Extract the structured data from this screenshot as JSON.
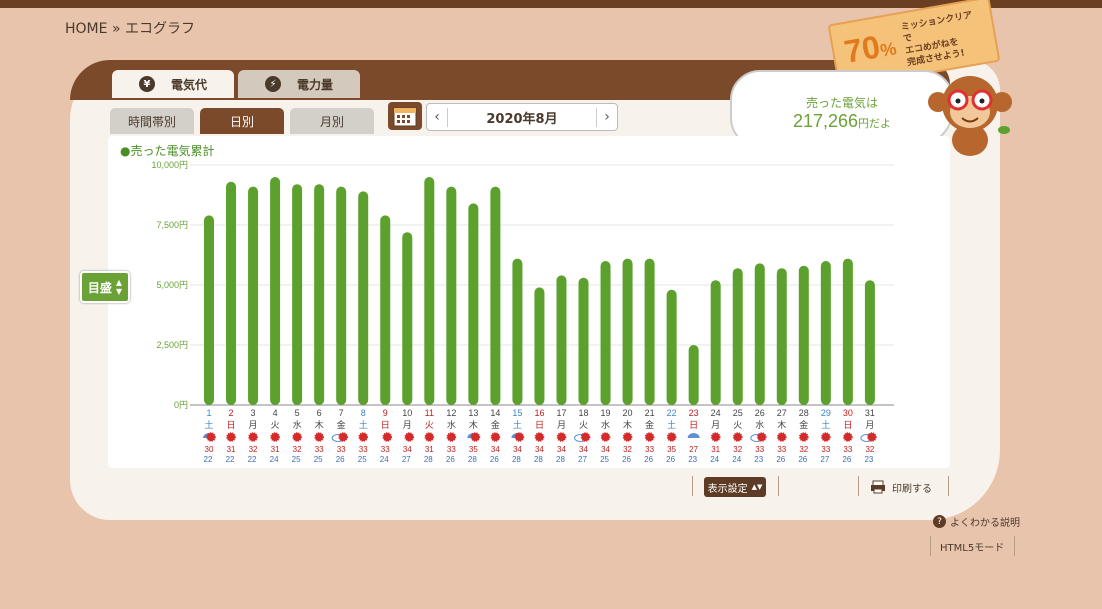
{
  "breadcrumb": {
    "home": "HOME",
    "sep": "»",
    "current": "エコグラフ"
  },
  "mission": {
    "percent": "70",
    "unit": "%",
    "text": "ミッションクリアで\nエコめがねを\n完成させよう!"
  },
  "tabs": [
    {
      "label": "電気代",
      "icon": "yen-icon"
    },
    {
      "label": "電力量",
      "icon": "bolt-icon"
    }
  ],
  "subtabs": [
    "時間帯別",
    "日別",
    "月別"
  ],
  "date": {
    "label": "2020年8月",
    "prev": "‹",
    "next": "›"
  },
  "summary": {
    "line1": "売った電気は",
    "value": "217,266",
    "unit": "円だよ"
  },
  "legend": "●売った電気累計",
  "scale_button": "目盛",
  "footer": {
    "display_settings": "表示設定",
    "print": "印刷する",
    "help": "よくわかる説明",
    "html5": "HTML5モード"
  },
  "colors": {
    "bar": "#5ca12d",
    "weekday": "#444444",
    "saturday": "#3c84cc",
    "sunday": "#c21c1c",
    "accent": "#6aa236"
  },
  "chart_data": {
    "type": "bar",
    "ylim": [
      0,
      10000
    ],
    "yticks": [
      "0円",
      "2,500円",
      "5,000円",
      "7,500円",
      "10,000円"
    ],
    "categories": [
      "1",
      "2",
      "3",
      "4",
      "5",
      "6",
      "7",
      "8",
      "9",
      "10",
      "11",
      "12",
      "13",
      "14",
      "15",
      "16",
      "17",
      "18",
      "19",
      "20",
      "21",
      "22",
      "23",
      "24",
      "25",
      "26",
      "27",
      "28",
      "29",
      "30",
      "31"
    ],
    "weekdays": [
      "土",
      "日",
      "月",
      "火",
      "水",
      "木",
      "金",
      "土",
      "日",
      "月",
      "火",
      "水",
      "木",
      "金",
      "土",
      "日",
      "月",
      "火",
      "水",
      "木",
      "金",
      "土",
      "日",
      "月",
      "火",
      "水",
      "木",
      "金",
      "土",
      "日",
      "月"
    ],
    "day_types": [
      "sat",
      "sun",
      "wd",
      "wd",
      "wd",
      "wd",
      "wd",
      "sat",
      "sun",
      "wd",
      "sun",
      "wd",
      "wd",
      "wd",
      "sat",
      "sun",
      "wd",
      "wd",
      "wd",
      "wd",
      "wd",
      "sat",
      "sun",
      "wd",
      "wd",
      "wd",
      "wd",
      "wd",
      "sat",
      "sun",
      "wd"
    ],
    "values": [
      7900,
      9300,
      9100,
      9500,
      9200,
      9200,
      9100,
      8900,
      7900,
      7200,
      9500,
      9100,
      8400,
      9100,
      6100,
      4900,
      5400,
      5300,
      6000,
      6100,
      6100,
      4800,
      2500,
      5200,
      5700,
      5900,
      5700,
      5800,
      6000,
      6100,
      5200
    ],
    "weather": [
      "sun-rain",
      "sun",
      "sun",
      "sun",
      "sun",
      "sun",
      "cloud-sun",
      "sun",
      "sun-cloud",
      "sun-cloud",
      "sun",
      "sun",
      "sun-rain",
      "sun",
      "sun-rain",
      "sun",
      "sun",
      "cloud-sun",
      "sun",
      "sun",
      "sun",
      "sun",
      "rain",
      "sun",
      "sun",
      "cloud-sun",
      "sun",
      "sun",
      "sun",
      "sun",
      "cloud-sun"
    ],
    "temp_high": [
      "30",
      "31",
      "32",
      "31",
      "32",
      "33",
      "33",
      "33",
      "33",
      "34",
      "31",
      "33",
      "35",
      "34",
      "34",
      "34",
      "34",
      "34",
      "34",
      "32",
      "33",
      "35",
      "27",
      "31",
      "32",
      "33",
      "33",
      "32",
      "33",
      "33",
      "32"
    ],
    "temp_low": [
      "22",
      "22",
      "22",
      "24",
      "25",
      "25",
      "26",
      "25",
      "24",
      "27",
      "28",
      "26",
      "28",
      "26",
      "28",
      "28",
      "28",
      "27",
      "25",
      "26",
      "26",
      "26",
      "23",
      "24",
      "24",
      "23",
      "26",
      "26",
      "27",
      "26",
      "23"
    ]
  }
}
